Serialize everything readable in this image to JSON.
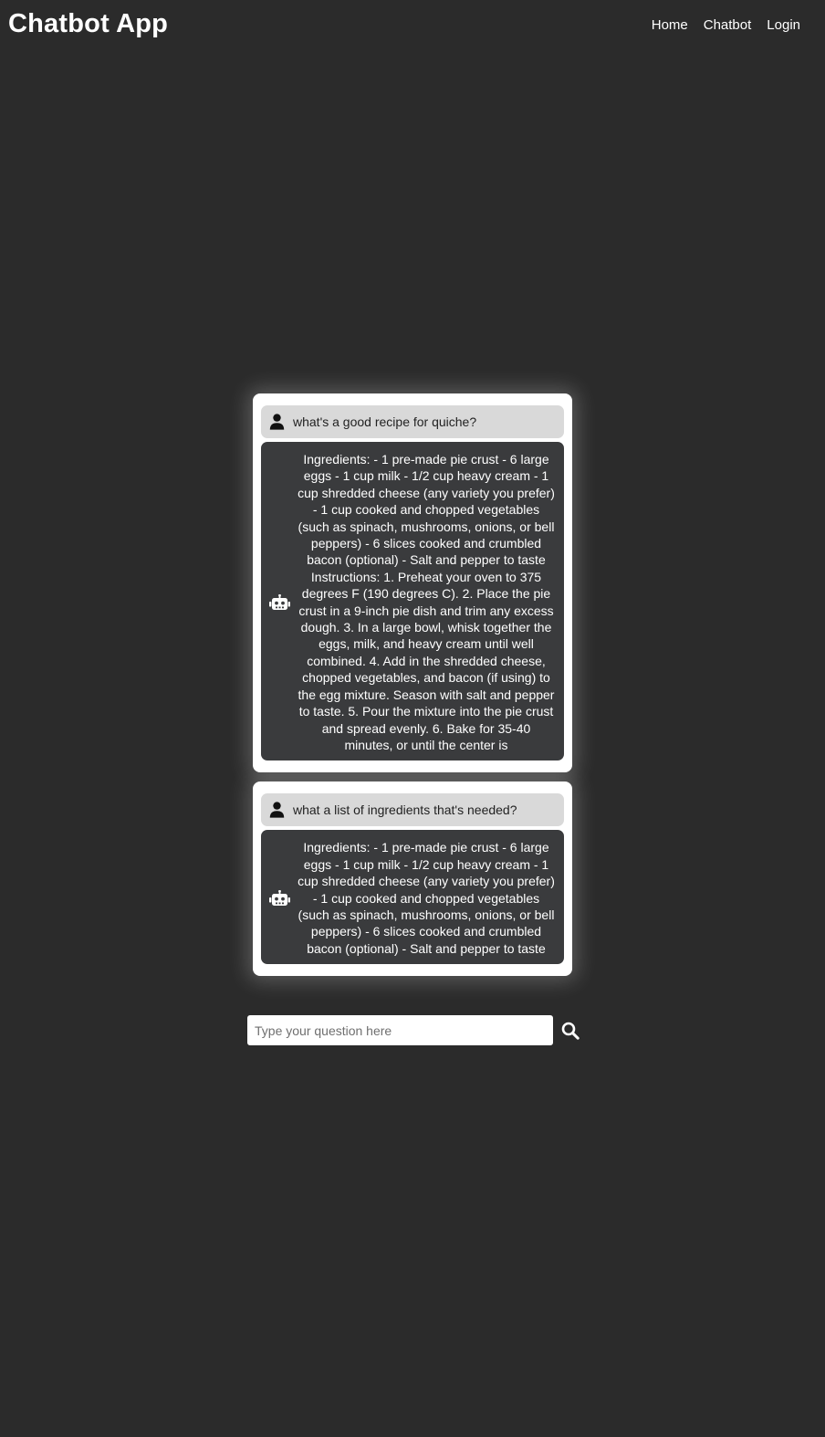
{
  "app": {
    "title": "Chatbot App"
  },
  "nav": {
    "items": [
      {
        "label": "Home"
      },
      {
        "label": "Chatbot"
      },
      {
        "label": "Login"
      }
    ]
  },
  "conversation": [
    {
      "question": "what's a good recipe for quiche?",
      "answer": "Ingredients: - 1 pre-made pie crust - 6 large eggs - 1 cup milk - 1/2 cup heavy cream - 1 cup shredded cheese (any variety you prefer) - 1 cup cooked and chopped vegetables (such as spinach, mushrooms, onions, or bell peppers) - 6 slices cooked and crumbled bacon (optional) - Salt and pepper to taste Instructions: 1. Preheat your oven to 375 degrees F (190 degrees C). 2. Place the pie crust in a 9-inch pie dish and trim any excess dough. 3. In a large bowl, whisk together the eggs, milk, and heavy cream until well combined. 4. Add in the shredded cheese, chopped vegetables, and bacon (if using) to the egg mixture. Season with salt and pepper to taste. 5. Pour the mixture into the pie crust and spread evenly. 6. Bake for 35-40 minutes, or until the center is"
    },
    {
      "question": "what a list of ingredients that's needed?",
      "answer": "Ingredients: - 1 pre-made pie crust - 6 large eggs - 1 cup milk - 1/2 cup heavy cream - 1 cup shredded cheese (any variety you prefer) - 1 cup cooked and chopped vegetables (such as spinach, mushrooms, onions, or bell peppers) - 6 slices cooked and crumbled bacon (optional) - Salt and pepper to taste"
    }
  ],
  "search": {
    "placeholder": "Type your question here",
    "value": ""
  },
  "icons": {
    "user": "user-icon",
    "bot": "robot-icon",
    "search": "search-icon"
  },
  "colors": {
    "background": "#2b2b2b",
    "card": "#ffffff",
    "user_bubble": "#d9d9d9",
    "bot_bubble": "#3a3b3d"
  }
}
